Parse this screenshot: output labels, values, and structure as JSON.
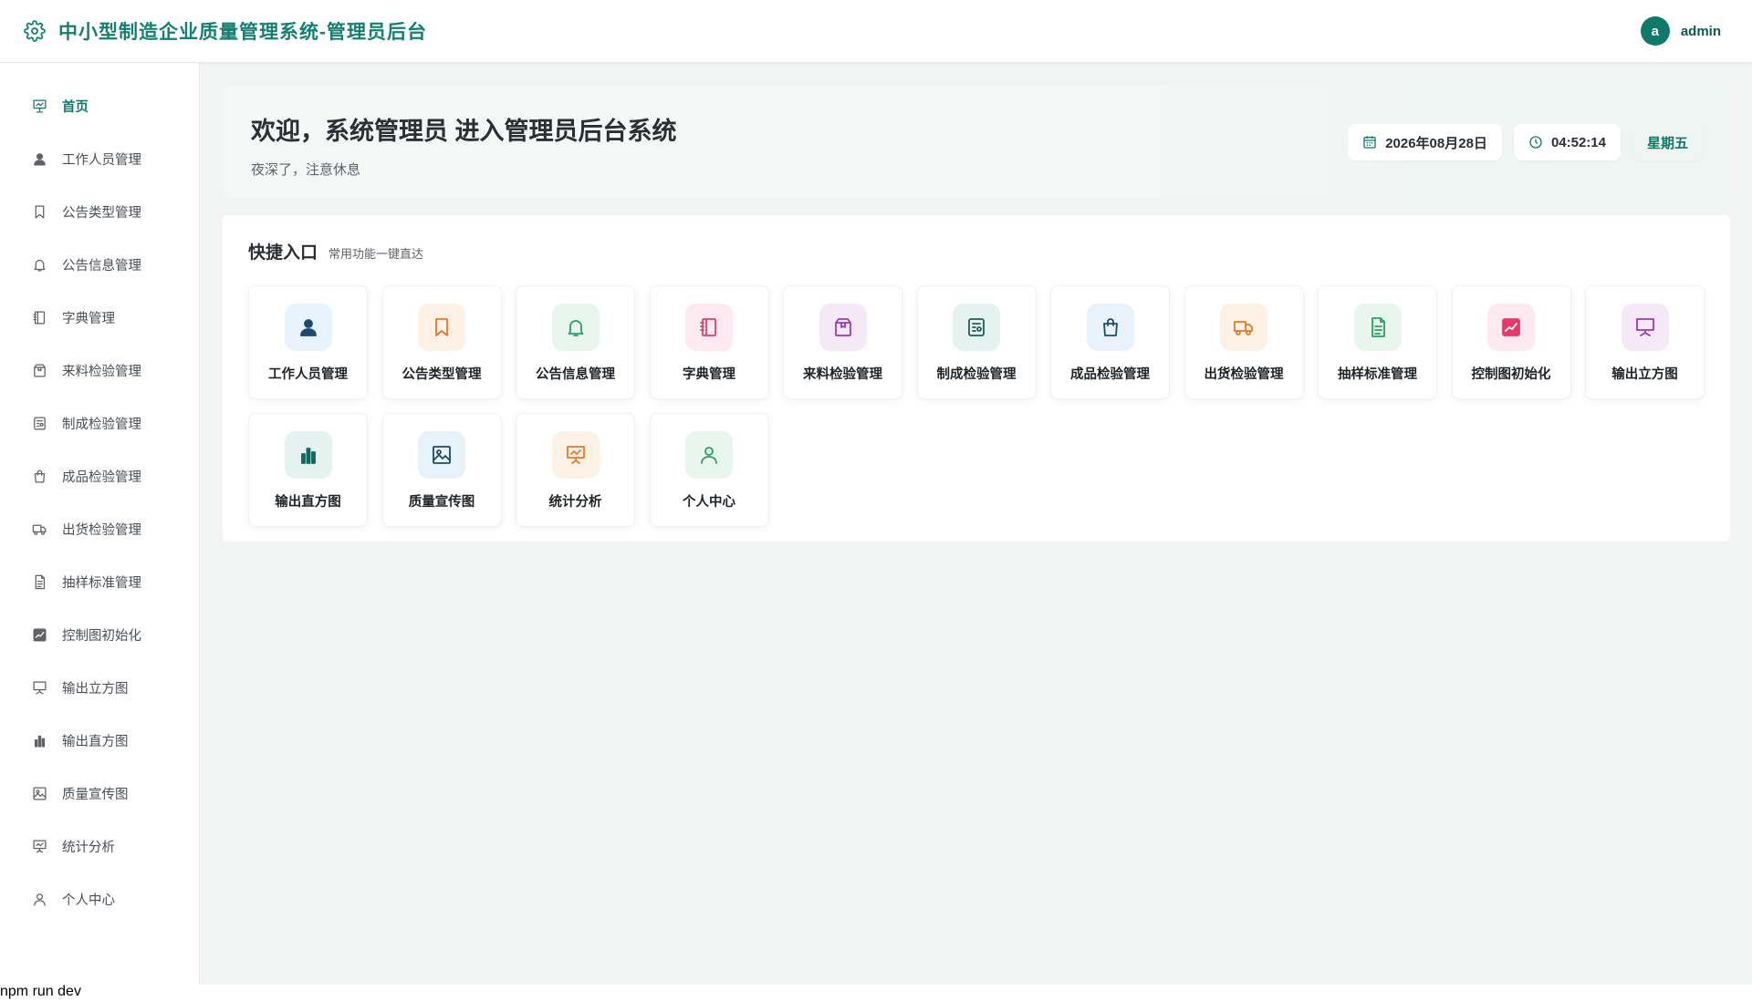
{
  "header": {
    "title": "中小型制造企业质量管理系统-管理员后台",
    "avatar_letter": "a",
    "username": "admin",
    "brand_color": "#15806f"
  },
  "sidebar": {
    "items": [
      {
        "label": "首页",
        "icon": "home-presentation-icon",
        "active": true
      },
      {
        "label": "工作人员管理",
        "icon": "user-icon"
      },
      {
        "label": "公告类型管理",
        "icon": "bookmark-icon"
      },
      {
        "label": "公告信息管理",
        "icon": "bell-icon"
      },
      {
        "label": "字典管理",
        "icon": "notebook-icon"
      },
      {
        "label": "来料检验管理",
        "icon": "box-icon"
      },
      {
        "label": "制成检验管理",
        "icon": "panel-icon"
      },
      {
        "label": "成品检验管理",
        "icon": "shopping-bag-icon"
      },
      {
        "label": "出货检验管理",
        "icon": "truck-icon"
      },
      {
        "label": "抽样标准管理",
        "icon": "document-icon"
      },
      {
        "label": "控制图初始化",
        "icon": "line-chart-icon"
      },
      {
        "label": "输出立方图",
        "icon": "presentation-board-icon"
      },
      {
        "label": "输出直方图",
        "icon": "bar-chart-icon"
      },
      {
        "label": "质量宣传图",
        "icon": "picture-icon"
      },
      {
        "label": "统计分析",
        "icon": "statistics-board-icon"
      },
      {
        "label": "个人中心",
        "icon": "user-outline-icon"
      }
    ]
  },
  "welcome": {
    "title": "欢迎，系统管理员 进入管理员后台系统",
    "subtitle": "夜深了，注意休息",
    "date": "2026年08月28日",
    "time": "04:52:14",
    "weekday": "星期五"
  },
  "quick": {
    "title": "快捷入口",
    "subtitle": "常用功能一键直达",
    "items": [
      {
        "label": "工作人员管理",
        "icon": "user-icon",
        "bg": "#e8f3fb",
        "fg": "#1e4a6b"
      },
      {
        "label": "公告类型管理",
        "icon": "bookmark-icon",
        "bg": "#fdf1e6",
        "fg": "#e07a2e"
      },
      {
        "label": "公告信息管理",
        "icon": "bell-icon",
        "bg": "#e8f6ee",
        "fg": "#2e9e63"
      },
      {
        "label": "字典管理",
        "icon": "notebook-icon",
        "bg": "#fde9ef",
        "fg": "#d8456f"
      },
      {
        "label": "来料检验管理",
        "icon": "box-icon",
        "bg": "#f5e9f7",
        "fg": "#9b3ab0"
      },
      {
        "label": "制成检验管理",
        "icon": "panel-icon",
        "bg": "#e4f2f0",
        "fg": "#1e5f58"
      },
      {
        "label": "成品检验管理",
        "icon": "shopping-bag-icon",
        "bg": "#e8f2fb",
        "fg": "#1e4a6b"
      },
      {
        "label": "出货检验管理",
        "icon": "truck-icon",
        "bg": "#fdf1e6",
        "fg": "#e07a2e"
      },
      {
        "label": "抽样标准管理",
        "icon": "document-icon",
        "bg": "#e8f6ee",
        "fg": "#2e9e63"
      },
      {
        "label": "控制图初始化",
        "icon": "line-chart-icon",
        "bg": "#fde9ef",
        "fg": "#e23a6a"
      },
      {
        "label": "输出立方图",
        "icon": "presentation-board-icon",
        "bg": "#f5e9f7",
        "fg": "#9b3ab0"
      },
      {
        "label": "输出直方图",
        "icon": "bar-chart-icon",
        "bg": "#e4f2f0",
        "fg": "#0f6a5c"
      },
      {
        "label": "质量宣传图",
        "icon": "picture-icon",
        "bg": "#e8f2fb",
        "fg": "#1e4a6b"
      },
      {
        "label": "统计分析",
        "icon": "statistics-board-icon",
        "bg": "#fdf1e6",
        "fg": "#e07a2e"
      },
      {
        "label": "个人中心",
        "icon": "user-outline-icon",
        "bg": "#e8f6ee",
        "fg": "#2e9e63"
      }
    ]
  },
  "footer": {
    "text": "npm run dev"
  }
}
